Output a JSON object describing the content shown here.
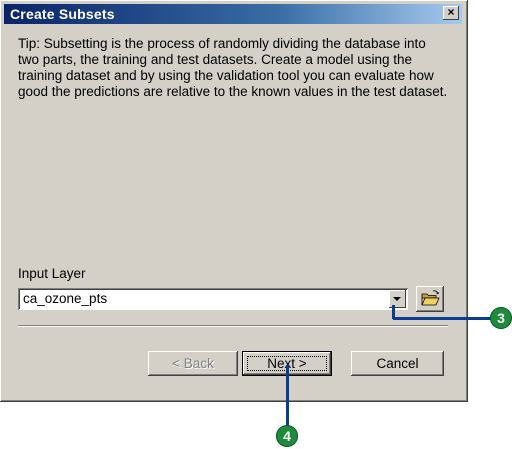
{
  "window": {
    "title": "Create Subsets",
    "close_glyph": "×"
  },
  "tip": {
    "text": "Tip:  Subsetting is the process of randomly dividing the database into two parts, the training and test datasets. Create a model using the training dataset and by using the validation tool you can evaluate how good the predictions are relative to the known values in the test dataset."
  },
  "input_layer": {
    "label": "Input Layer",
    "value": "ca_ozone_pts"
  },
  "buttons": {
    "back": "< Back",
    "next": "Next >",
    "cancel": "Cancel"
  },
  "callouts": {
    "dropdown": "3",
    "next": "4"
  },
  "icons": {
    "open_folder": "open-folder-icon"
  }
}
